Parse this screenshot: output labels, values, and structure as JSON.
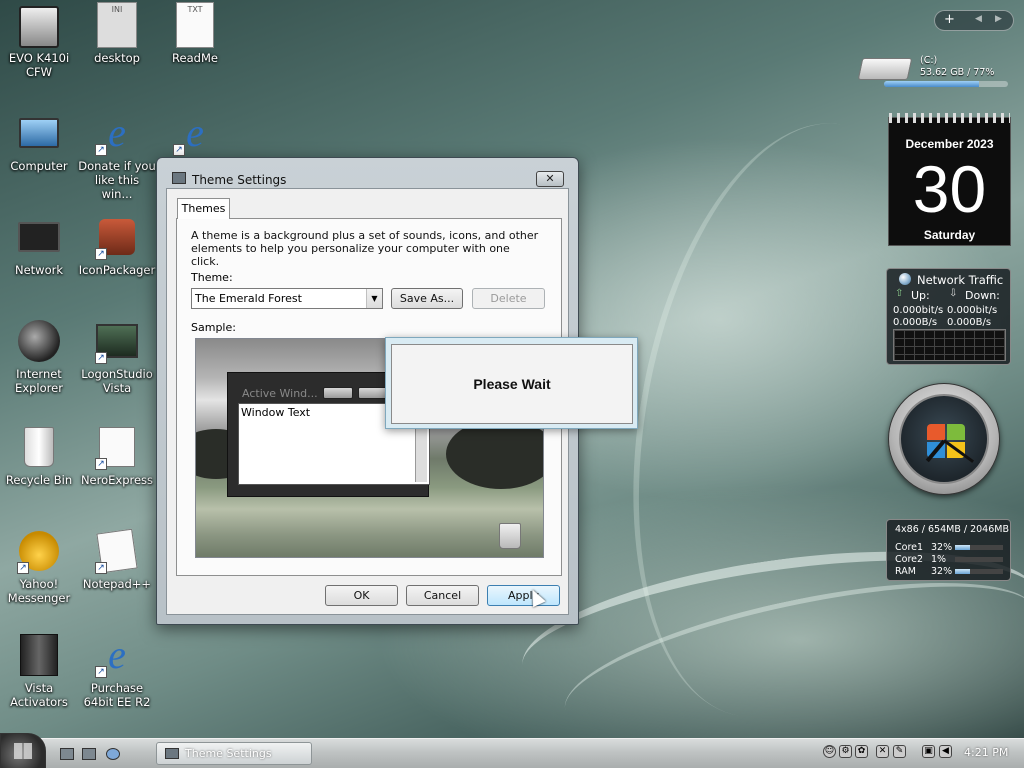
{
  "desktop": {
    "icons": [
      {
        "label": "EVO K410i CFW"
      },
      {
        "label": "desktop"
      },
      {
        "label": "ReadMe"
      },
      {
        "label": "Computer"
      },
      {
        "label": "Donate if you like this win..."
      },
      {
        "label": "Network"
      },
      {
        "label": "IconPackager"
      },
      {
        "label": "Internet Explorer"
      },
      {
        "label": "LogonStudio Vista"
      },
      {
        "label": "Recycle Bin"
      },
      {
        "label": "NeroExpress"
      },
      {
        "label": "Yahoo! Messenger"
      },
      {
        "label": "Notepad++"
      },
      {
        "label": "Vista Activators"
      },
      {
        "label": "Purchase 64bit EE R2"
      }
    ],
    "icon_badges": {
      "ini": "INI",
      "txt": "TXT"
    }
  },
  "dialog": {
    "title": "Theme Settings",
    "close_glyph": "✕",
    "tab": "Themes",
    "description": "A theme is a background plus a set of sounds, icons, and other elements to help you personalize your computer with one click.",
    "theme_label": "Theme:",
    "theme_value": "The Emerald Forest",
    "save_as": "Save As...",
    "delete": "Delete",
    "sample_label": "Sample:",
    "sample_window_title": "Active Wind...",
    "sample_window_text": "Window Text",
    "ok": "OK",
    "cancel": "Cancel",
    "apply": "Apply"
  },
  "popup": {
    "text": "Please Wait"
  },
  "gadgets": {
    "topbar": {
      "add": "+",
      "prev": "◀",
      "next": "▶"
    },
    "drive": {
      "label": "(C:)",
      "stats": "53.62 GB / 77%",
      "fill_fraction": 0.77
    },
    "calendar": {
      "month": "December 2023",
      "day": "30",
      "weekday": "Saturday"
    },
    "network": {
      "title": "Network Traffic",
      "up_label": "Up:",
      "down_label": "Down:",
      "up_bits": "0.000bit/s",
      "down_bits": "0.000bit/s",
      "up_bytes": "0.000B/s",
      "down_bytes": "0.000B/s"
    },
    "cpu": {
      "header": "4x86 / 654MB / 2046MB",
      "rows": [
        {
          "name": "Core1",
          "value": "32%",
          "fraction": 0.32
        },
        {
          "name": "Core2",
          "value": "1%",
          "fraction": 0.01
        },
        {
          "name": "RAM",
          "value": "32%",
          "fraction": 0.32
        }
      ]
    }
  },
  "taskbar": {
    "task_button": "Theme Settings",
    "clock": "4:21 PM"
  },
  "colors": {
    "dialog_frame": "#3e4a52",
    "popup_border": "#7fa8bd"
  }
}
